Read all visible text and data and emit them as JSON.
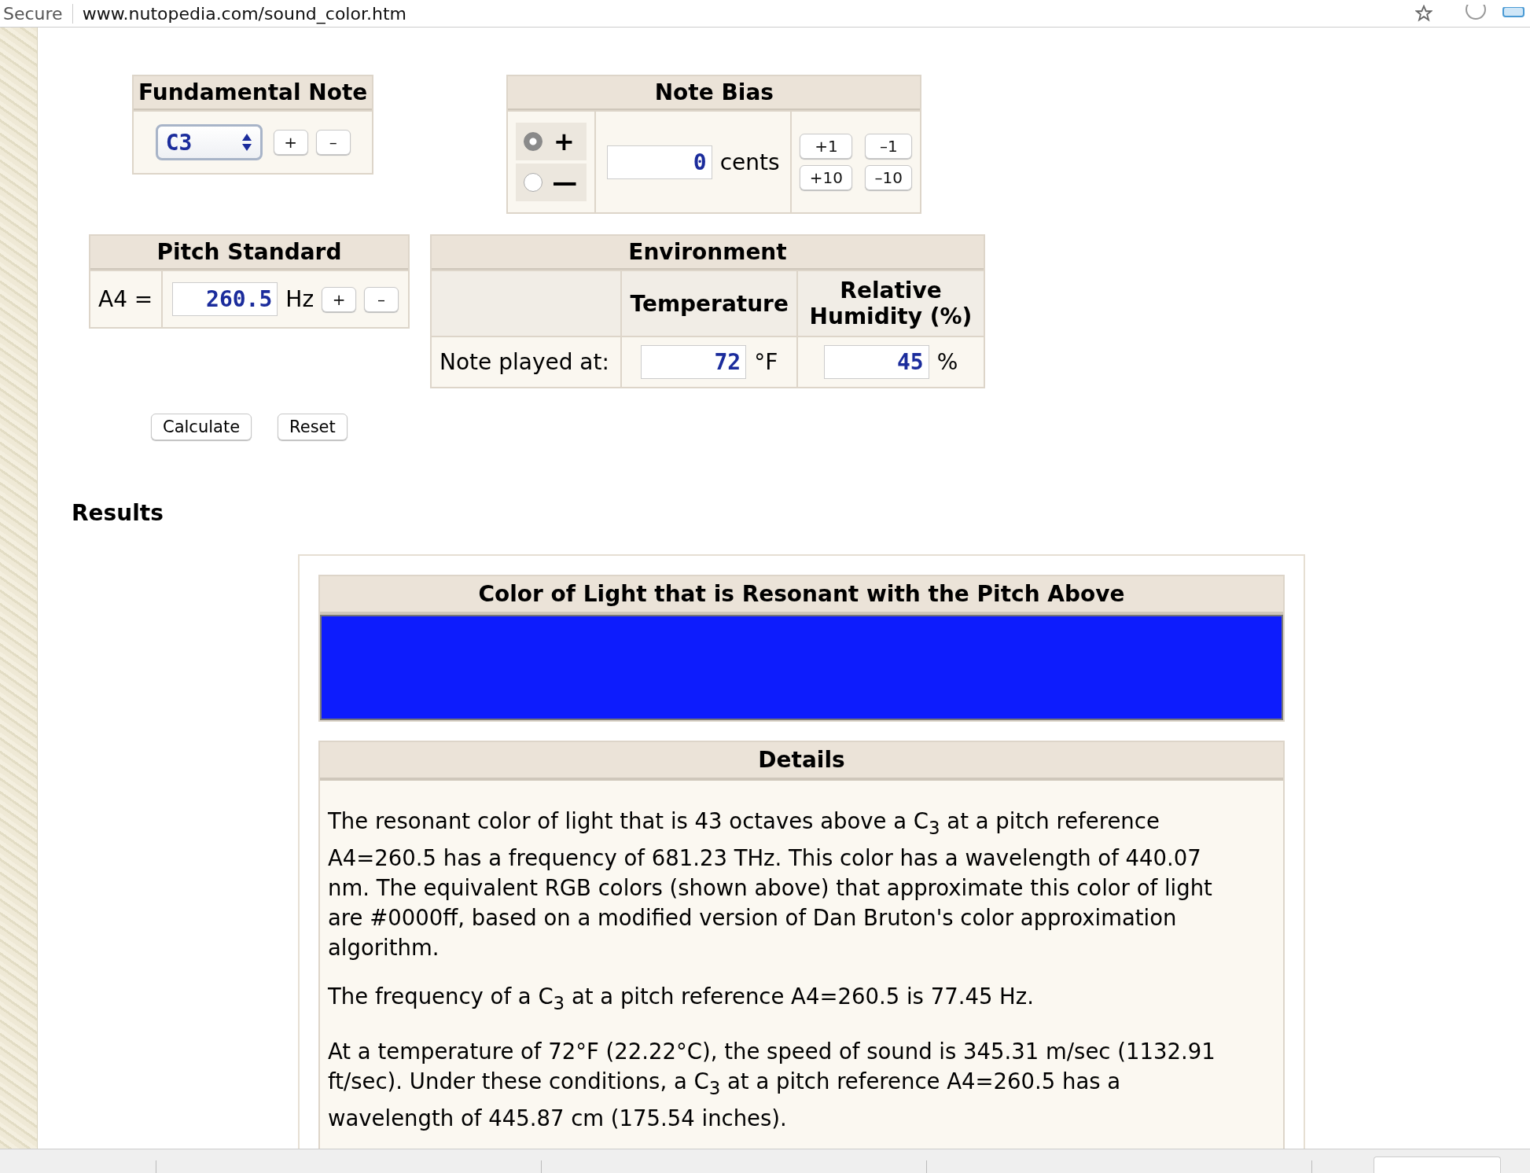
{
  "browser": {
    "security": "Secure",
    "url": "www.nutopedia.com/sound_color.htm"
  },
  "fundamental_note": {
    "title": "Fundamental Note",
    "note": "C3",
    "buttons": [
      "+",
      "–"
    ]
  },
  "note_bias": {
    "title": "Note Bias",
    "signs": [
      {
        "label": "+",
        "selected": true
      },
      {
        "label": "—",
        "selected": false
      }
    ],
    "value": "0",
    "unit": "cents",
    "buttons": [
      "+1",
      "–1",
      "+10",
      "–10"
    ]
  },
  "pitch_standard": {
    "title": "Pitch Standard",
    "label": "A4 =",
    "value": "260.5",
    "unit": "Hz",
    "buttons": [
      "+",
      "–"
    ]
  },
  "environment": {
    "title": "Environment",
    "columns": [
      "Temperature",
      "Relative Humidity (%)"
    ],
    "row_label": "Note played at:",
    "temperature": "72",
    "temperature_unit": "°F",
    "humidity": "45",
    "humidity_unit": "%"
  },
  "actions": [
    "Calculate",
    "Reset"
  ],
  "results": {
    "title": "Results",
    "color_title": "Color of Light that is Resonant with the Pitch Above",
    "color": "#0d1cfd",
    "details_title": "Details",
    "paragraphs": [
      "The resonant color of light that is 43 octaves above a C$_{3}$ at a pitch reference A4=260.5 has a frequency of 681.23 THz. This color has a wavelength of 440.07 nm. The equivalent RGB colors (shown above) that approximate this color of light are #0000ff, based on a modified version of Dan Bruton's color approximation algorithm.",
      "The frequency of a C$_{3}$ at a pitch reference A4=260.5 is 77.45 Hz.",
      "At a temperature of 72°F (22.22°C), the speed of sound is 345.31 m/sec (1132.91 ft/sec). Under these conditions, a C$_{3}$ at a pitch reference A4=260.5 has a wavelength of 445.87 cm (175.54 inches)."
    ]
  }
}
